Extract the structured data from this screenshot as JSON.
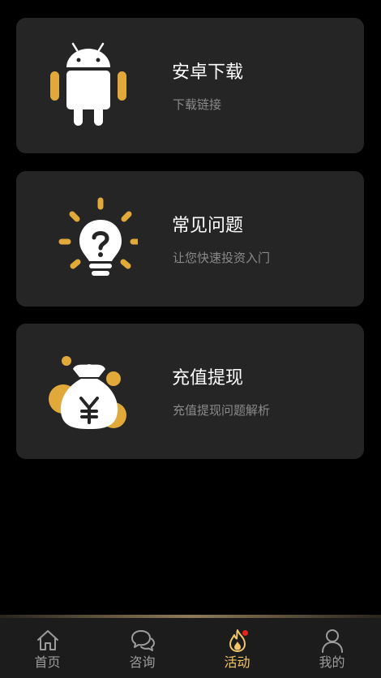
{
  "cards": [
    {
      "title": "安卓下载",
      "subtitle": "下载链接",
      "icon": "android-icon"
    },
    {
      "title": "常见问题",
      "subtitle": "让您快速投资入门",
      "icon": "lightbulb-question-icon"
    },
    {
      "title": "充值提现",
      "subtitle": "充值提现问题解析",
      "icon": "money-bag-yen-icon"
    }
  ],
  "tabs": [
    {
      "label": "首页",
      "icon": "home-icon",
      "active": false
    },
    {
      "label": "咨询",
      "icon": "chat-bubbles-icon",
      "active": false
    },
    {
      "label": "活动",
      "icon": "flame-icon",
      "active": true,
      "badge_dot": true
    },
    {
      "label": "我的",
      "icon": "user-icon",
      "active": false
    }
  ],
  "colors": {
    "background": "#000000",
    "card_background": "#252525",
    "accent_gold": "#E0A93A",
    "active_tab_text": "#F1C56A",
    "inactive_tab_text": "#9C9C9C",
    "badge_red": "#E8231D"
  }
}
